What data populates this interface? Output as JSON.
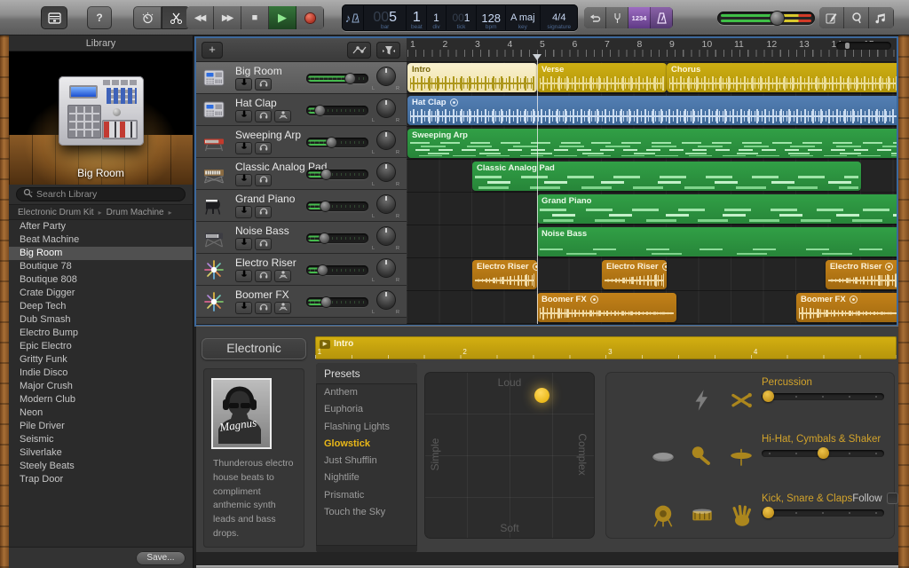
{
  "toolbar": {
    "lcd": {
      "bar_pad": "00",
      "bar": "5",
      "beat": "1",
      "div": "1",
      "tick_pad": "00",
      "tick": "1",
      "bpm": "128",
      "key": "A maj",
      "signature": "4/4",
      "labels": {
        "bar": "bar",
        "beat": "beat",
        "div": "div",
        "tick": "tick",
        "bpm": "bpm",
        "key": "key",
        "signature": "signature"
      }
    },
    "count_in_label": "1234",
    "master_volume": 0.62
  },
  "library": {
    "title": "Library",
    "instrument_name": "Big Room",
    "search_placeholder": "Search Library",
    "breadcrumb": [
      "Electronic Drum Kit",
      "Drum Machine"
    ],
    "items": [
      "After Party",
      "Beat Machine",
      "Big Room",
      "Boutique 78",
      "Boutique 808",
      "Crate Digger",
      "Deep Tech",
      "Dub Smash",
      "Electro Bump",
      "Epic Electro",
      "Gritty Funk",
      "Indie Disco",
      "Major Crush",
      "Modern Club",
      "Neon",
      "Pile Driver",
      "Seismic",
      "Silverlake",
      "Steely Beats",
      "Trap Door"
    ],
    "selected": "Big Room",
    "save_label": "Save..."
  },
  "timeline": {
    "bar_width": 36.5,
    "ruler_numbers": [
      1,
      2,
      3,
      4,
      5,
      6,
      7,
      8,
      9,
      10,
      11,
      12,
      13,
      14,
      15
    ],
    "playhead_bar": 5
  },
  "tracks": [
    {
      "name": "Big Room",
      "icon": "drum-machine",
      "selected": true,
      "volume": 0.7,
      "buttons": [
        "mute",
        "solo"
      ],
      "regions": [
        {
          "label": "Intro",
          "start": 1,
          "end": 5,
          "color": "yellow",
          "pattern": "flat",
          "selected": true,
          "loop": false
        },
        {
          "label": "Verse",
          "start": 5,
          "end": 9,
          "color": "yellow",
          "pattern": "flat",
          "selected": false,
          "loop": false
        },
        {
          "label": "Chorus",
          "start": 9,
          "end": 16.2,
          "color": "yellow",
          "pattern": "flat",
          "selected": false,
          "loop": false
        }
      ]
    },
    {
      "name": "Hat Clap",
      "icon": "drum-machine",
      "selected": false,
      "volume": 0.22,
      "buttons": [
        "mute",
        "solo",
        "input"
      ],
      "regions": [
        {
          "label": "Hat Clap",
          "start": 1,
          "end": 16.2,
          "color": "blue",
          "pattern": "flat",
          "selected": false,
          "loop": true
        }
      ]
    },
    {
      "name": "Sweeping Arp",
      "icon": "synth-red",
      "selected": false,
      "volume": 0.4,
      "buttons": [
        "mute",
        "solo"
      ],
      "regions": [
        {
          "label": "Sweeping Arp",
          "start": 1,
          "end": 16.2,
          "color": "green",
          "pattern": "dense",
          "selected": false,
          "loop": false
        }
      ]
    },
    {
      "name": "Classic Analog Pad",
      "icon": "synth-keyboard",
      "selected": false,
      "volume": 0.32,
      "buttons": [
        "mute",
        "solo"
      ],
      "regions": [
        {
          "label": "Classic Analog Pad",
          "start": 3,
          "end": 15,
          "color": "green",
          "pattern": "mid",
          "selected": false,
          "loop": false
        }
      ]
    },
    {
      "name": "Grand Piano",
      "icon": "grand-piano",
      "selected": false,
      "volume": 0.3,
      "buttons": [
        "mute",
        "solo"
      ],
      "regions": [
        {
          "label": "Grand Piano",
          "start": 5,
          "end": 16.2,
          "color": "green",
          "pattern": "mid",
          "selected": false,
          "loop": false
        }
      ]
    },
    {
      "name": "Noise Bass",
      "icon": "synth-stand",
      "selected": false,
      "volume": 0.28,
      "buttons": [
        "mute",
        "solo"
      ],
      "regions": [
        {
          "label": "Noise Bass",
          "start": 5,
          "end": 16.2,
          "color": "green",
          "pattern": "sparse",
          "selected": false,
          "loop": false
        }
      ]
    },
    {
      "name": "Electro Riser",
      "icon": "starburst",
      "selected": false,
      "volume": 0.25,
      "buttons": [
        "mute",
        "solo",
        "input"
      ],
      "regions": [
        {
          "label": "Electro Riser",
          "start": 3,
          "end": 5,
          "color": "orange",
          "pattern": "riser",
          "selected": false,
          "loop": true
        },
        {
          "label": "Electro Riser",
          "start": 7,
          "end": 9,
          "color": "orange",
          "pattern": "riser",
          "selected": false,
          "loop": true
        },
        {
          "label": "Electro Riser",
          "start": 13.9,
          "end": 16.2,
          "color": "orange",
          "pattern": "riser",
          "selected": false,
          "loop": true
        }
      ]
    },
    {
      "name": "Boomer FX",
      "icon": "starburst",
      "selected": false,
      "volume": 0.32,
      "buttons": [
        "mute",
        "solo",
        "input"
      ],
      "regions": [
        {
          "label": "Boomer FX",
          "start": 5,
          "end": 9.3,
          "color": "orange",
          "pattern": "boom",
          "selected": false,
          "loop": true
        },
        {
          "label": "Boomer FX",
          "start": 13,
          "end": 16.2,
          "color": "orange",
          "pattern": "boom",
          "selected": false,
          "loop": true
        }
      ]
    }
  ],
  "smart_controls": {
    "genre_label": "Electronic",
    "artist_signature": "Magnus",
    "description": "Thunderous electro house beats to compliment anthemic synth leads and bass drops.",
    "mini_timeline": {
      "label": "Intro",
      "ticks": [
        "1",
        "2",
        "3",
        "4"
      ]
    },
    "presets": {
      "header": "Presets",
      "selected": "Glowstick",
      "items": [
        "Anthem",
        "Euphoria",
        "Flashing Lights",
        "Glowstick",
        "Just Shufflin",
        "Nightlife",
        "Prismatic",
        "Touch the Sky"
      ]
    },
    "xy_pad": {
      "top": "Loud",
      "bottom": "Soft",
      "left": "Simple",
      "right": "Complex",
      "dot_x": 0.685,
      "dot_y": 0.14
    },
    "groups": [
      {
        "label": "Percussion",
        "value": 0.05,
        "follow": false,
        "follow_label": "",
        "icons": [
          {
            "name": "lightning",
            "active": false
          },
          {
            "name": "drumsticks",
            "active": true
          }
        ]
      },
      {
        "label": "Hi-Hat, Cymbals & Shaker",
        "value": 0.5,
        "follow": false,
        "follow_label": "",
        "icons": [
          {
            "name": "tambourine",
            "active": false
          },
          {
            "name": "maraca",
            "active": true
          },
          {
            "name": "cymbal",
            "active": true
          }
        ]
      },
      {
        "label": "Kick, Snare & Claps",
        "value": 0.05,
        "follow": true,
        "follow_label": "Follow",
        "icons": [
          {
            "name": "gong-drum",
            "active": true
          },
          {
            "name": "snare-drum",
            "active": true
          },
          {
            "name": "clap-hand",
            "active": true
          }
        ]
      }
    ],
    "colors": {
      "accent_yellow": "#eab718",
      "region_green": "#2e9440",
      "region_blue": "#4b79ae",
      "region_orange": "#bf7e16",
      "region_yellow": "#c0a00c"
    }
  }
}
